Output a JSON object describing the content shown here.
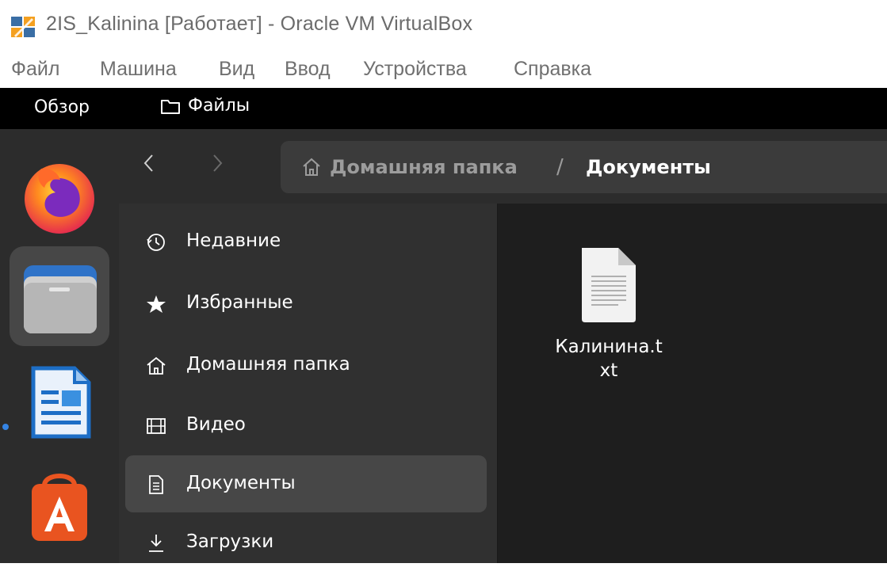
{
  "window": {
    "title": "2IS_Kalinina [Работает] - Oracle VM VirtualBox",
    "menu": [
      "Файл",
      "Машина",
      "Вид",
      "Ввод",
      "Устройства",
      "Справка"
    ]
  },
  "topbar": {
    "overview": "Обзор",
    "app_name": "Файлы"
  },
  "dock": {
    "items": [
      {
        "name": "Firefox",
        "icon": "firefox-icon",
        "running": false
      },
      {
        "name": "Files",
        "icon": "files-icon",
        "running": true,
        "active": true
      },
      {
        "name": "LibreOffice Writer",
        "icon": "writer-icon",
        "running": false
      },
      {
        "name": "App Center",
        "icon": "app-center-icon",
        "running": false
      }
    ]
  },
  "pathbar": {
    "home": "Домашняя папка",
    "separator": "/",
    "current": "Документы"
  },
  "sidebar": {
    "items": [
      {
        "label": "Недавние",
        "icon": "clock-icon"
      },
      {
        "label": "Избранные",
        "icon": "star-icon"
      },
      {
        "label": "Домашняя папка",
        "icon": "home-icon"
      },
      {
        "label": "Видео",
        "icon": "film-icon"
      },
      {
        "label": "Документы",
        "icon": "document-icon",
        "selected": true
      },
      {
        "label": "Загрузки",
        "icon": "download-icon"
      }
    ]
  },
  "content": {
    "files": [
      {
        "name": "Калинина.t\nxt",
        "icon": "text-file-icon"
      }
    ]
  },
  "colors": {
    "accent": "#3584e4",
    "sidebar_bg": "#303030",
    "content_bg": "#1e1e1e",
    "selected_bg": "#474747"
  }
}
